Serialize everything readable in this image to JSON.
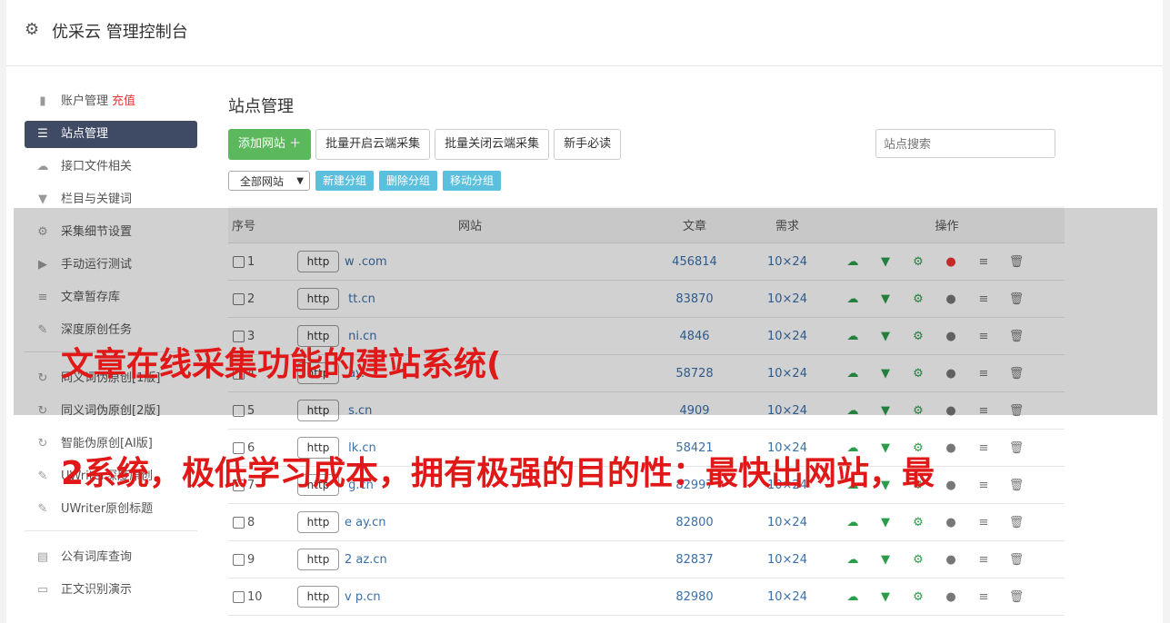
{
  "header": {
    "title": "优采云 管理控制台",
    "icon": "gear-icon"
  },
  "sidebar": {
    "items": [
      {
        "label": "账户管理",
        "extra": "充值",
        "icon": "bar-chart-icon",
        "glyph": "▮"
      },
      {
        "label": "站点管理",
        "icon": "server-icon",
        "glyph": "☰",
        "active": true
      },
      {
        "label": "接口文件相关",
        "icon": "cloud-upload-icon",
        "glyph": "☁"
      },
      {
        "label": "栏目与关键词",
        "icon": "filter-icon",
        "glyph": "▼"
      },
      {
        "label": "采集细节设置",
        "icon": "cogs-icon",
        "glyph": "⚙"
      },
      {
        "label": "手动运行测试",
        "icon": "play-circle-icon",
        "glyph": "▶"
      },
      {
        "label": "文章暂存库",
        "icon": "database-icon",
        "glyph": "≡"
      },
      {
        "label": "深度原创任务",
        "icon": "edit-icon",
        "glyph": "✎"
      },
      {
        "label": "同义词伪原创[1版]",
        "icon": "refresh-icon",
        "glyph": "↻"
      },
      {
        "label": "同义词伪原创[2版]",
        "icon": "refresh-icon",
        "glyph": "↻"
      },
      {
        "label": "智能伪原创[AI版]",
        "icon": "refresh-icon",
        "glyph": "↻"
      },
      {
        "label": "UWriter深度原创",
        "icon": "edit-icon",
        "glyph": "✎"
      },
      {
        "label": "UWriter原创标题",
        "icon": "edit-icon",
        "glyph": "✎"
      },
      {
        "label": "公有词库查询",
        "icon": "book-icon",
        "glyph": "▤"
      },
      {
        "label": "正文识别演示",
        "icon": "monitor-icon",
        "glyph": "▭"
      }
    ]
  },
  "main": {
    "title": "站点管理",
    "buttons": {
      "add": "添加网站 ＋",
      "batch_on": "批量开启云端采集",
      "batch_off": "批量关闭云端采集",
      "guide": "新手必读"
    },
    "search_placeholder": "站点搜索",
    "group_select": "全部网站",
    "group_buttons": {
      "new": "新建分组",
      "delete": "删除分组",
      "move": "移动分组"
    },
    "table": {
      "headers": {
        "seq": "序号",
        "site": "网站",
        "articles": "文章",
        "demand": "需求",
        "ops": "操作"
      },
      "rows": [
        {
          "seq": "1",
          "http": "http",
          "site": "w           .com",
          "articles": "456814",
          "demand": "10×24",
          "active": true
        },
        {
          "seq": "2",
          "http": "http",
          "site": "    tt.cn",
          "articles": "83870",
          "demand": "10×24"
        },
        {
          "seq": "3",
          "http": "http",
          "site": "      ni.cn",
          "articles": "4846",
          "demand": "10×24"
        },
        {
          "seq": "4",
          "http": "http",
          "site": "         ay.",
          "articles": "58728",
          "demand": "10×24"
        },
        {
          "seq": "5",
          "http": "http",
          "site": "        s.cn",
          "articles": "4909",
          "demand": "10×24"
        },
        {
          "seq": "6",
          "http": "http",
          "site": "      lk.cn",
          "articles": "58421",
          "demand": "10×24"
        },
        {
          "seq": "7",
          "http": "http",
          "site": "       g.cn",
          "articles": "82997",
          "demand": "10×24"
        },
        {
          "seq": "8",
          "http": "http",
          "site": "e      ay.cn",
          "articles": "82800",
          "demand": "10×24"
        },
        {
          "seq": "9",
          "http": "http",
          "site": "2     az.cn",
          "articles": "82837",
          "demand": "10×24"
        },
        {
          "seq": "10",
          "http": "http",
          "site": "v     p.cn",
          "articles": "82980",
          "demand": "10×24"
        }
      ]
    }
  },
  "overlay": {
    "line1": "文章在线采集功能的建站系统(",
    "line2": "2系统，极低学习成本，拥有极强的目的性：最快出网站，最"
  },
  "colors": {
    "accent": "#5cb85c",
    "info": "#5bc0de",
    "sidebar_active": "#3f4a64",
    "overlay_text": "#e01818"
  }
}
